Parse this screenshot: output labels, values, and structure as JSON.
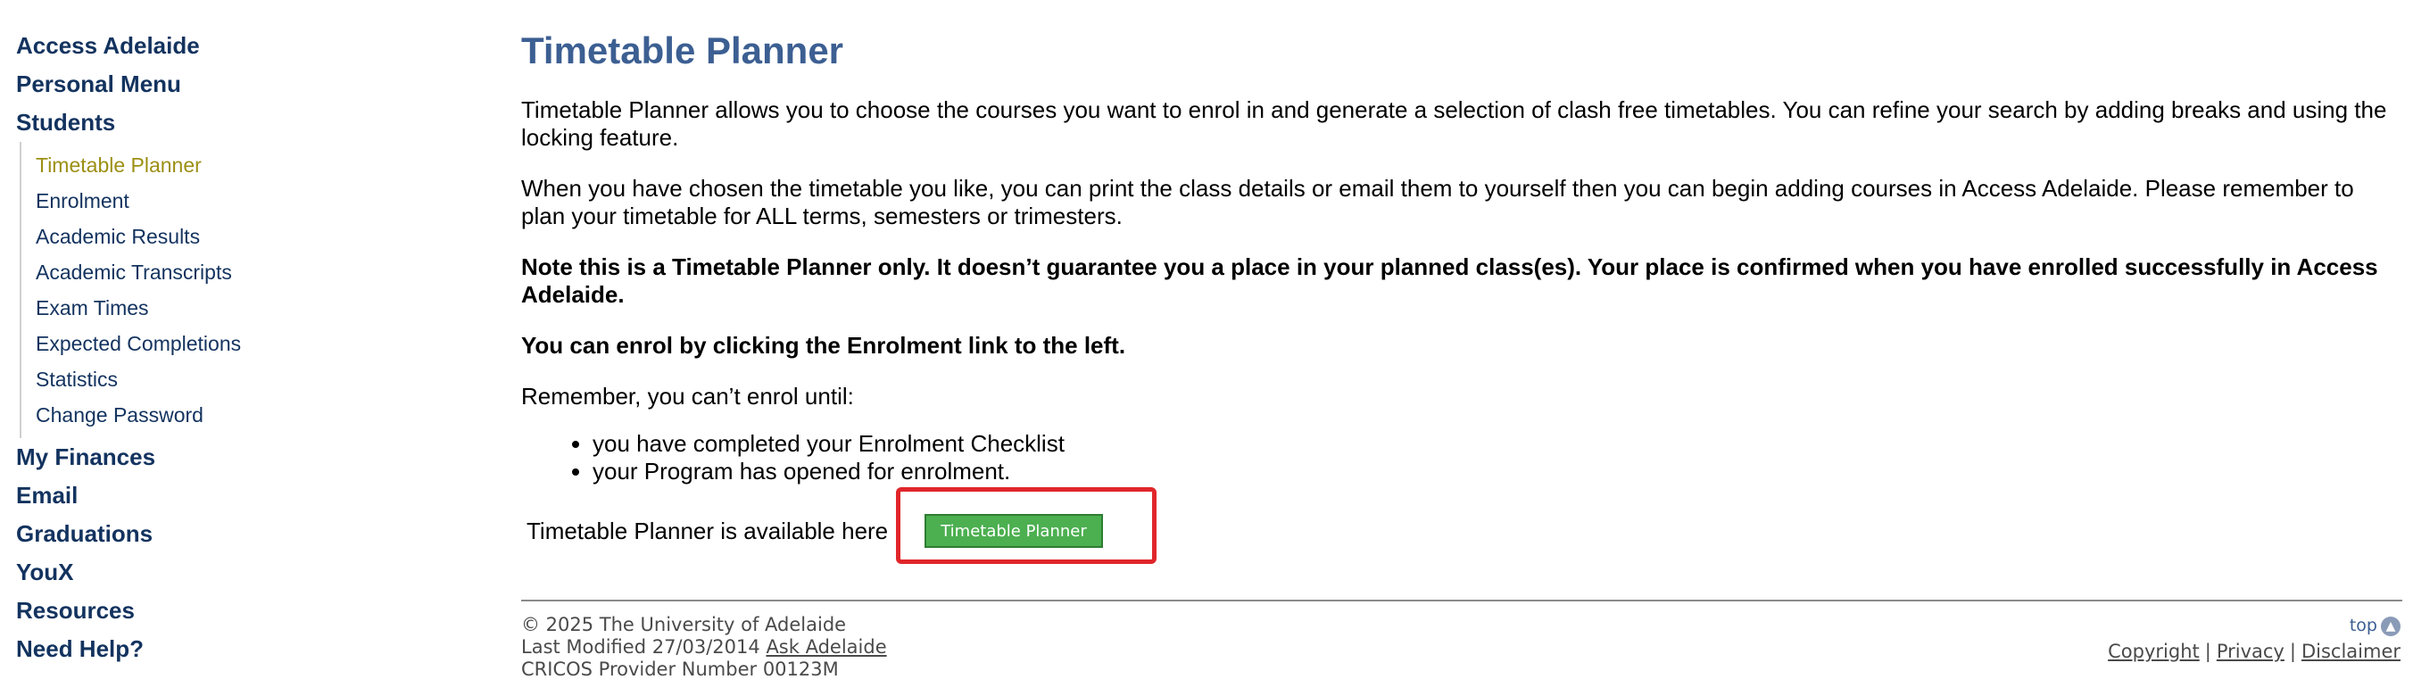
{
  "sidebar": {
    "top_items": [
      {
        "label": "Access Adelaide"
      },
      {
        "label": "Personal Menu"
      },
      {
        "label": "Students"
      }
    ],
    "student_items": [
      {
        "label": "Timetable Planner",
        "active": true
      },
      {
        "label": "Enrolment"
      },
      {
        "label": "Academic Results"
      },
      {
        "label": "Academic Transcripts"
      },
      {
        "label": "Exam Times"
      },
      {
        "label": "Expected Completions"
      },
      {
        "label": "Statistics"
      },
      {
        "label": "Change Password"
      }
    ],
    "bottom_items": [
      {
        "label": "My Finances"
      },
      {
        "label": "Email"
      },
      {
        "label": "Graduations"
      },
      {
        "label": "YouX"
      },
      {
        "label": "Resources"
      },
      {
        "label": "Need Help?"
      }
    ]
  },
  "main": {
    "title": "Timetable Planner",
    "para1": "Timetable Planner allows you to choose the courses you want to enrol in and generate a selection of clash free timetables. You can refine your search by adding breaks and using the locking feature.",
    "para2": "When you have chosen the timetable you like, you can print the class details or email them to yourself then you can begin adding courses in Access Adelaide. Please remember to plan your timetable for ALL terms, semesters or trimesters.",
    "note": "Note this is a Timetable Planner only. It doesn’t guarantee you a place in your planned class(es). Your place is confirmed when you have enrolled successfully in Access Adelaide.",
    "enrol_note": "You can enrol by clicking the Enrolment link to the left.",
    "remember": "Remember, you can’t enrol until:",
    "bullets": [
      "you have completed your Enrolment Checklist",
      "your Program has opened for enrolment."
    ],
    "available_text": "Timetable Planner is available here",
    "button_label": "Timetable Planner"
  },
  "footer": {
    "copyright": "© 2025 The University of Adelaide",
    "last_modified": "Last Modified 27/03/2014",
    "ask_link": "Ask Adelaide",
    "cricos": "CRICOS Provider Number 00123M",
    "top_label": "top",
    "links": {
      "copyright": "Copyright",
      "privacy": "Privacy",
      "disclaimer": "Disclaimer"
    }
  },
  "colors": {
    "nav": "#13335f",
    "nav_active": "#9c8f14",
    "title": "#3c5f92",
    "button": "#4caf50",
    "highlight": "#e0262b"
  }
}
